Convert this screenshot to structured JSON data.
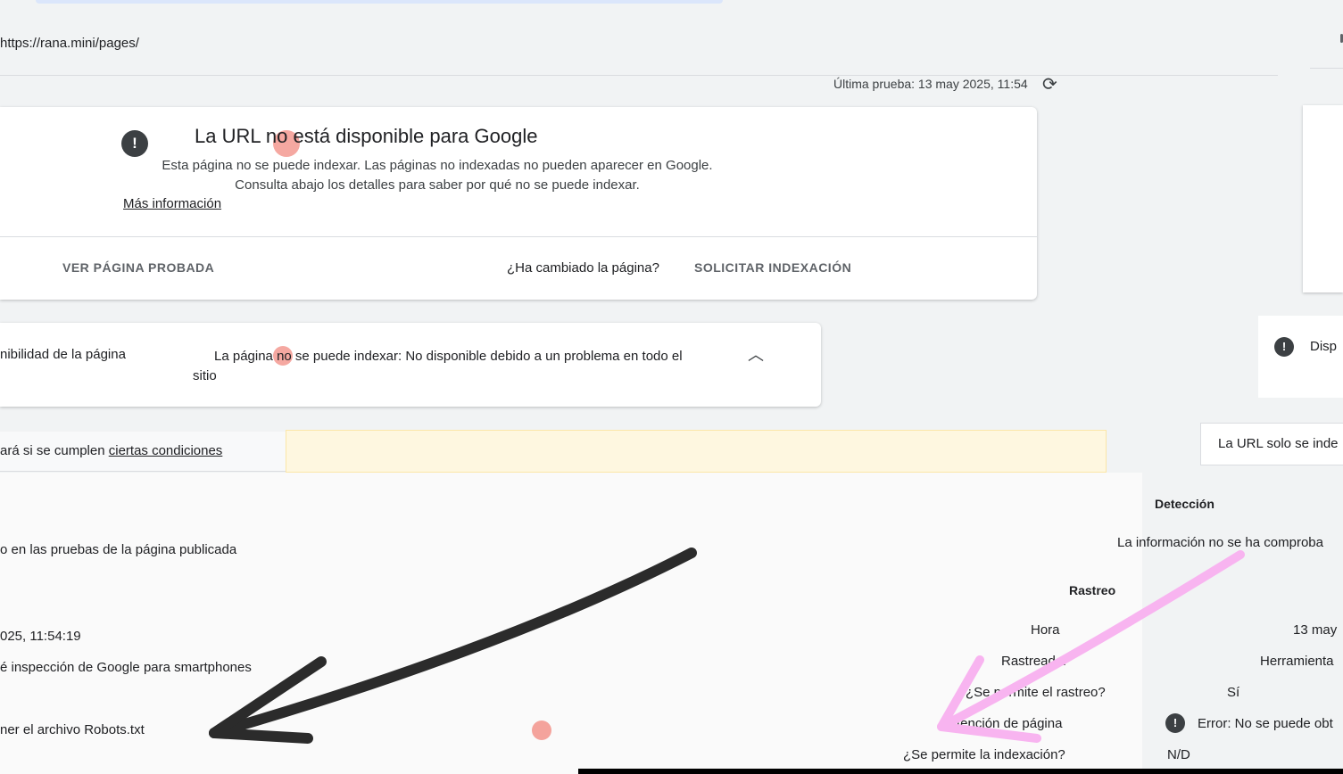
{
  "header": {
    "url": "https://rana.mini/pages/",
    "last_test": "Última prueba: 13 may 2025, 11:54"
  },
  "status": {
    "title": "La URL no está disponible para Google",
    "description": "Esta página no se puede indexar. Las páginas no indexadas no pueden aparecer en Google. Consulta abajo los detalles para saber por qué no se puede indexar.",
    "more_link": "Más información",
    "view_tested_page": "VER PÁGINA PROBADA",
    "changed_question": "¿Ha cambiado la página?",
    "request_indexing": "SOLICITAR INDEXACIÓN"
  },
  "availability": {
    "label": "nibilidad de la página",
    "value_line1": "La página no se puede indexar: No disponible debido a un problema en todo el",
    "value_line2": "sitio"
  },
  "conditions": {
    "prefix": "ará si se cumplen ",
    "link": "ciertas condiciones"
  },
  "details": {
    "tested_note": "o en las pruebas de la página publicada",
    "time": "025, 11:54:19",
    "crawler": "é inspección de Google para smartphones",
    "robots": "ner el archivo Robots.txt"
  },
  "right_panel": {
    "availability": "Disp",
    "url_only": "La URL solo se inde",
    "detection_header": "Detección",
    "detection_value": "La información no se ha comproba",
    "crawl_header": "Rastreo",
    "rows": [
      {
        "label": "Hora",
        "value": "13 may"
      },
      {
        "label": "Rastreador",
        "value": "Herramienta"
      },
      {
        "label": "¿Se permite el rastreo?",
        "value": "Sí"
      },
      {
        "label": "Obtención de página",
        "value": "Error: No se puede obt"
      },
      {
        "label": "¿Se permite la indexación?",
        "value": "N/D"
      }
    ]
  },
  "icons": {
    "warning": "warning-icon",
    "refresh": "refresh-icon",
    "chevron": "chevron-up-icon",
    "error": "error-icon"
  },
  "colors": {
    "warning_bg": "#fef7e0",
    "error": "#f28b82",
    "annotation_arrow_pink": "#f8b4f0",
    "annotation_arrow_black": "#2b2b2b"
  }
}
